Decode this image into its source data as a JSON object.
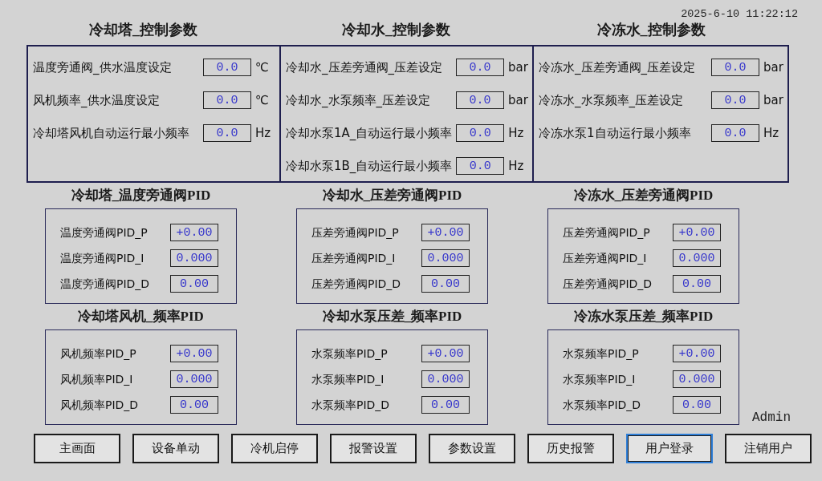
{
  "datetime": "2025-6-10 11:22:12",
  "control_panels": [
    {
      "title": "冷却塔_控制参数",
      "params": [
        {
          "label": "温度旁通阀_供水温度设定",
          "value": "0.0",
          "unit": "℃"
        },
        {
          "label": "风机频率_供水温度设定",
          "value": "0.0",
          "unit": "℃"
        },
        {
          "label": "冷却塔风机自动运行最小频率",
          "value": "0.0",
          "unit": "Hz"
        }
      ]
    },
    {
      "title": "冷却水_控制参数",
      "params": [
        {
          "label": "冷却水_压差旁通阀_压差设定",
          "value": "0.0",
          "unit": "bar"
        },
        {
          "label": "冷却水_水泵频率_压差设定",
          "value": "0.0",
          "unit": "bar"
        },
        {
          "label": "冷却水泵1A_自动运行最小频率",
          "value": "0.0",
          "unit": "Hz"
        },
        {
          "label": "冷却水泵1B_自动运行最小频率",
          "value": "0.0",
          "unit": "Hz"
        }
      ]
    },
    {
      "title": "冷冻水_控制参数",
      "params": [
        {
          "label": "冷冻水_压差旁通阀_压差设定",
          "value": "0.0",
          "unit": "bar"
        },
        {
          "label": "冷冻水_水泵频率_压差设定",
          "value": "0.0",
          "unit": "bar"
        },
        {
          "label": "冷冻水泵1自动运行最小频率",
          "value": "0.0",
          "unit": "Hz"
        }
      ]
    }
  ],
  "pid_panels": [
    {
      "title": "冷却塔_温度旁通阀PID",
      "params": [
        {
          "label": "温度旁通阀PID_P",
          "value": "+0.00"
        },
        {
          "label": "温度旁通阀PID_I",
          "value": "0.000"
        },
        {
          "label": "温度旁通阀PID_D",
          "value": "0.00"
        }
      ]
    },
    {
      "title": "冷却水_压差旁通阀PID",
      "params": [
        {
          "label": "压差旁通阀PID_P",
          "value": "+0.00"
        },
        {
          "label": "压差旁通阀PID_I",
          "value": "0.000"
        },
        {
          "label": "压差旁通阀PID_D",
          "value": "0.00"
        }
      ]
    },
    {
      "title": "冷冻水_压差旁通阀PID",
      "params": [
        {
          "label": "压差旁通阀PID_P",
          "value": "+0.00"
        },
        {
          "label": "压差旁通阀PID_I",
          "value": "0.000"
        },
        {
          "label": "压差旁通阀PID_D",
          "value": "0.00"
        }
      ]
    },
    {
      "title": "冷却塔风机_频率PID",
      "params": [
        {
          "label": "风机频率PID_P",
          "value": "+0.00"
        },
        {
          "label": "风机频率PID_I",
          "value": "0.000"
        },
        {
          "label": "风机频率PID_D",
          "value": "0.00"
        }
      ]
    },
    {
      "title": "冷却水泵压差_频率PID",
      "params": [
        {
          "label": "水泵频率PID_P",
          "value": "+0.00"
        },
        {
          "label": "水泵频率PID_I",
          "value": "0.000"
        },
        {
          "label": "水泵频率PID_D",
          "value": "0.00"
        }
      ]
    },
    {
      "title": "冷冻水泵压差_频率PID",
      "params": [
        {
          "label": "水泵频率PID_P",
          "value": "+0.00"
        },
        {
          "label": "水泵频率PID_I",
          "value": "0.000"
        },
        {
          "label": "水泵频率PID_D",
          "value": "0.00"
        }
      ]
    }
  ],
  "user": "Admin",
  "nav_buttons": [
    {
      "label": "主画面",
      "selected": false
    },
    {
      "label": "设备单动",
      "selected": false
    },
    {
      "label": "冷机启停",
      "selected": false
    },
    {
      "label": "报警设置",
      "selected": false
    },
    {
      "label": "参数设置",
      "selected": false
    },
    {
      "label": "历史报警",
      "selected": false
    },
    {
      "label": "用户登录",
      "selected": true
    },
    {
      "label": "注销用户",
      "selected": false
    }
  ]
}
